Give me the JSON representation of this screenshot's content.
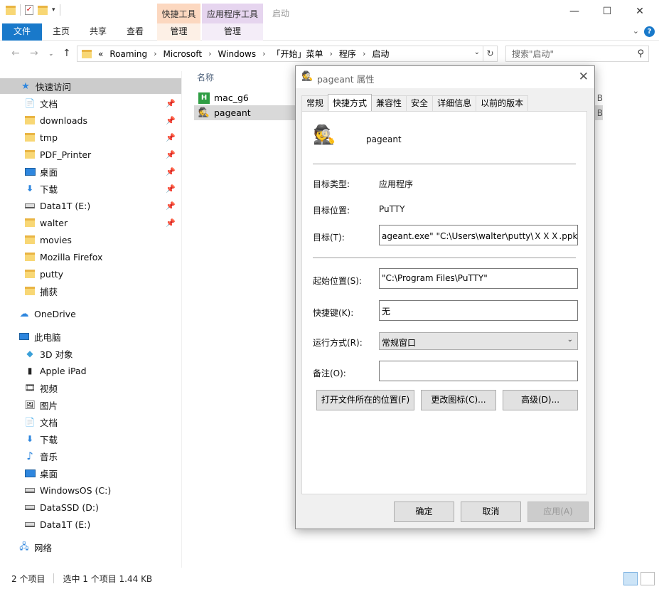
{
  "window": {
    "title": "启动",
    "context_tab_1": "快捷工具",
    "context_tab_2": "应用程序工具",
    "min_glyph": "—",
    "max_glyph": "☐",
    "close_glyph": "✕"
  },
  "ribbon": {
    "file": "文件",
    "home": "主页",
    "share": "共享",
    "view": "查看",
    "manage_1": "管理",
    "manage_2": "管理",
    "help": "?"
  },
  "address": {
    "overflow": "«",
    "crumbs": [
      "Roaming",
      "Microsoft",
      "Windows",
      "「开始」菜单",
      "程序",
      "启动"
    ],
    "search_placeholder": "搜索\"启动\""
  },
  "navigation": {
    "quick_access": "快速访问",
    "pinned": [
      {
        "label": "文档",
        "icon": "documents-icon"
      },
      {
        "label": "downloads",
        "icon": "folder-icon"
      },
      {
        "label": "tmp",
        "icon": "folder-icon"
      },
      {
        "label": "PDF_Printer",
        "icon": "folder-icon"
      },
      {
        "label": "桌面",
        "icon": "desktop-icon"
      },
      {
        "label": "下载",
        "icon": "download-icon"
      },
      {
        "label": "Data1T (E:)",
        "icon": "drive-icon"
      },
      {
        "label": "walter",
        "icon": "folder-icon"
      }
    ],
    "recent": [
      {
        "label": "movies",
        "icon": "folder-icon"
      },
      {
        "label": "Mozilla Firefox",
        "icon": "folder-icon"
      },
      {
        "label": "putty",
        "icon": "folder-icon"
      },
      {
        "label": "捕获",
        "icon": "folder-icon"
      }
    ],
    "onedrive": "OneDrive",
    "this_pc": "此电脑",
    "pc_items": [
      {
        "label": "3D 对象",
        "icon": "3d-objects-icon"
      },
      {
        "label": "Apple iPad",
        "icon": "ipad-icon"
      },
      {
        "label": "视频",
        "icon": "videos-icon"
      },
      {
        "label": "图片",
        "icon": "pictures-icon"
      },
      {
        "label": "文档",
        "icon": "documents-icon"
      },
      {
        "label": "下载",
        "icon": "download-icon"
      },
      {
        "label": "音乐",
        "icon": "music-icon"
      },
      {
        "label": "桌面",
        "icon": "desktop-icon"
      },
      {
        "label": "WindowsOS (C:)",
        "icon": "drive-icon"
      },
      {
        "label": "DataSSD (D:)",
        "icon": "drive-icon"
      },
      {
        "label": "Data1T (E:)",
        "icon": "drive-icon"
      }
    ],
    "network": "网络"
  },
  "content": {
    "column_name": "名称",
    "files": [
      {
        "name": "mac_g6",
        "size_fragment": "B",
        "selected": false
      },
      {
        "name": "pageant",
        "size_fragment": "B",
        "selected": true
      }
    ]
  },
  "status": {
    "count": "2 个项目",
    "selection": "选中 1 个项目  1.44 KB"
  },
  "dialog": {
    "title": "pageant 属性",
    "tabs": [
      "常规",
      "快捷方式",
      "兼容性",
      "安全",
      "详细信息",
      "以前的版本"
    ],
    "active_tab": "快捷方式",
    "app_name": "pageant",
    "target_type_label": "目标类型:",
    "target_type_value": "应用程序",
    "target_location_label": "目标位置:",
    "target_location_value": "PuTTY",
    "target_label": "目标(T):",
    "target_value": "ageant.exe\" \"C:\\Users\\walter\\putty\\ＸＸＸ.ppk\"",
    "start_in_label": "起始位置(S):",
    "start_in_value": "\"C:\\Program Files\\PuTTY\"",
    "hotkey_label": "快捷键(K):",
    "hotkey_value": "无",
    "run_label": "运行方式(R):",
    "run_value": "常规窗口",
    "comment_label": "备注(O):",
    "comment_value": "",
    "open_location_button": "打开文件所在的位置(F)",
    "change_icon_button": "更改图标(C)...",
    "advanced_button": "高级(D)...",
    "ok_button": "确定",
    "cancel_button": "取消",
    "apply_button": "应用(A)"
  },
  "colors": {
    "accent": "#1979ca",
    "context_1": "#fcd8c0",
    "context_2": "#e6d5ef",
    "selection": "#cccccc"
  }
}
